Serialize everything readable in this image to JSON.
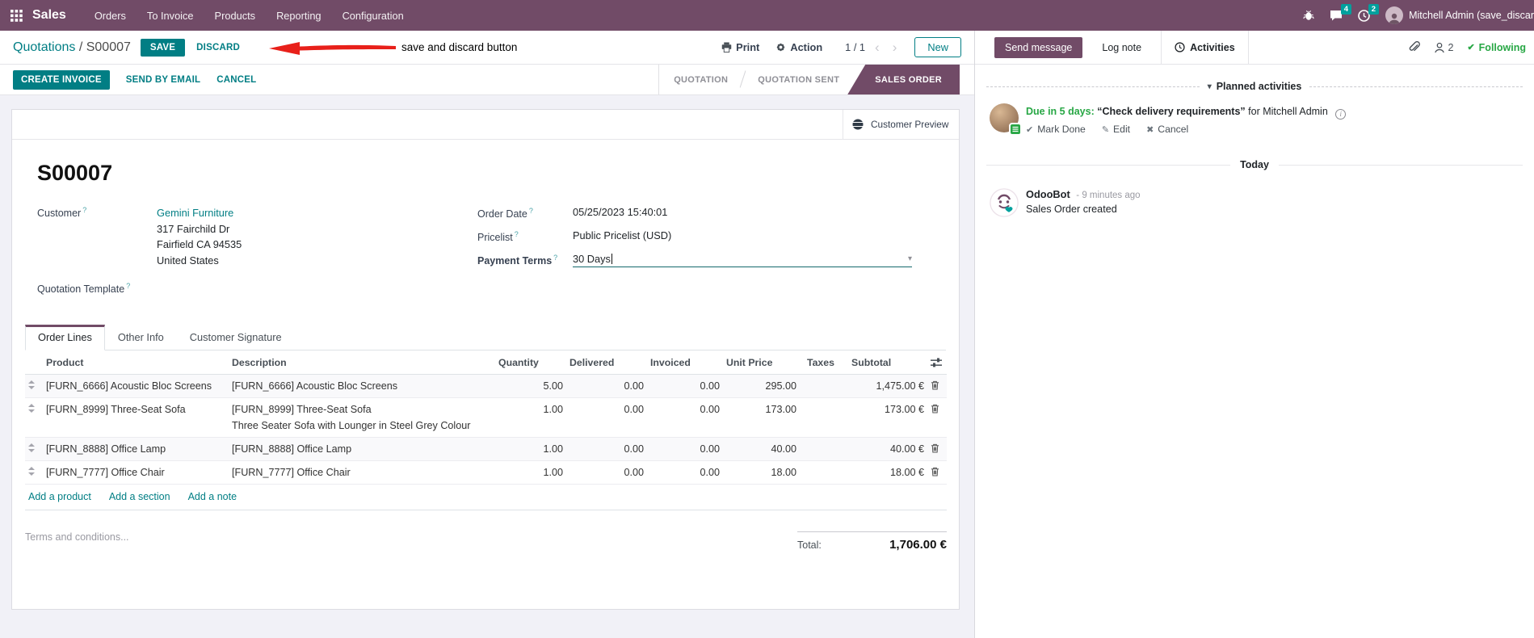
{
  "colors": {
    "brand": "#714B67",
    "accent": "#017E84",
    "badge": "#00A09D",
    "success": "#28a745",
    "annotation_arrow": "#e8201a"
  },
  "icons": {
    "caret_down": "▾",
    "chev_left": "‹",
    "chev_right": "›",
    "check": "✔",
    "pencil": "✎",
    "cross": "✖",
    "info": "i"
  },
  "topbar": {
    "app": "Sales",
    "menus": [
      "Orders",
      "To Invoice",
      "Products",
      "Reporting",
      "Configuration"
    ],
    "messages_badge": "4",
    "activities_badge": "2",
    "user": "Mitchell Admin (save_discar"
  },
  "control": {
    "breadcrumb": {
      "parent": "Quotations",
      "sep": " / ",
      "current": "S00007"
    },
    "save": "SAVE",
    "discard": "DISCARD",
    "annotation": "save and discard button",
    "print": "Print",
    "action": "Action",
    "pager": "1 / 1",
    "new": "New"
  },
  "statusbar": {
    "actions": [
      "CREATE INVOICE",
      "SEND BY EMAIL",
      "CANCEL"
    ],
    "steps": [
      "QUOTATION",
      "QUOTATION SENT",
      "SALES ORDER"
    ]
  },
  "sheet": {
    "help_marker": "?",
    "customer_preview": "Customer Preview",
    "title": "S00007",
    "fields": {
      "customer_label": "Customer",
      "customer_name": "Gemini Furniture",
      "address": [
        "317 Fairchild Dr",
        "Fairfield CA 94535",
        "United States"
      ],
      "template_label": "Quotation Template",
      "order_date_label": "Order Date",
      "order_date": "05/25/2023 15:40:01",
      "pricelist_label": "Pricelist",
      "pricelist": "Public Pricelist (USD)",
      "payment_label": "Payment Terms",
      "payment": "30 Days"
    },
    "tabs": [
      "Order Lines",
      "Other Info",
      "Customer Signature"
    ],
    "table": {
      "columns": [
        "Product",
        "Description",
        "Quantity",
        "Delivered",
        "Invoiced",
        "Unit Price",
        "Taxes",
        "Subtotal"
      ],
      "rows": [
        {
          "product": "[FURN_6666] Acoustic Bloc Screens",
          "description": "[FURN_6666] Acoustic Bloc Screens",
          "description2": "",
          "quantity": "5.00",
          "delivered": "0.00",
          "invoiced": "0.00",
          "unit_price": "295.00",
          "taxes": "",
          "subtotal": "1,475.00 €"
        },
        {
          "product": "[FURN_8999] Three-Seat Sofa",
          "description": "[FURN_8999] Three-Seat Sofa",
          "description2": "Three Seater Sofa with Lounger in Steel Grey Colour",
          "quantity": "1.00",
          "delivered": "0.00",
          "invoiced": "0.00",
          "unit_price": "173.00",
          "taxes": "",
          "subtotal": "173.00 €"
        },
        {
          "product": "[FURN_8888] Office Lamp",
          "description": "[FURN_8888] Office Lamp",
          "description2": "",
          "quantity": "1.00",
          "delivered": "0.00",
          "invoiced": "0.00",
          "unit_price": "40.00",
          "taxes": "",
          "subtotal": "40.00 €"
        },
        {
          "product": "[FURN_7777] Office Chair",
          "description": "[FURN_7777] Office Chair",
          "description2": "",
          "quantity": "1.00",
          "delivered": "0.00",
          "invoiced": "0.00",
          "unit_price": "18.00",
          "taxes": "",
          "subtotal": "18.00 €"
        }
      ]
    },
    "add_links": [
      "Add a product",
      "Add a section",
      "Add a note"
    ],
    "terms_placeholder": "Terms and conditions...",
    "total_label": "Total:",
    "total_value": "1,706.00 €"
  },
  "chatter": {
    "send_message": "Send message",
    "log_note": "Log note",
    "activities": "Activities",
    "followers_count": "2",
    "following": "Following",
    "planned_header": "Planned activities",
    "activity": {
      "due": "Due in 5 days:",
      "title": "“Check delivery requirements”",
      "assignee": "for Mitchell Admin",
      "mark_done": "Mark Done",
      "edit": "Edit",
      "cancel": "Cancel"
    },
    "today": "Today",
    "message": {
      "author": "OdooBot",
      "time": "- 9 minutes ago",
      "body": "Sales Order created"
    }
  }
}
